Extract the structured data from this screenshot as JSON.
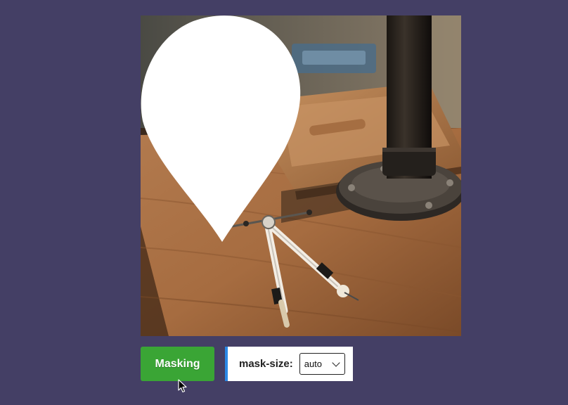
{
  "image": {
    "alt": "Drafting compass on a wooden desk",
    "mask_shape": "teardrop-pin-icon"
  },
  "toolbar": {
    "masking_label": "Masking",
    "mask_size_label": "mask-size:",
    "mask_size_value": "auto"
  },
  "colors": {
    "page_background": "#443f65",
    "button_green": "#3aa535",
    "panel_accent_blue": "#2b88e6"
  }
}
